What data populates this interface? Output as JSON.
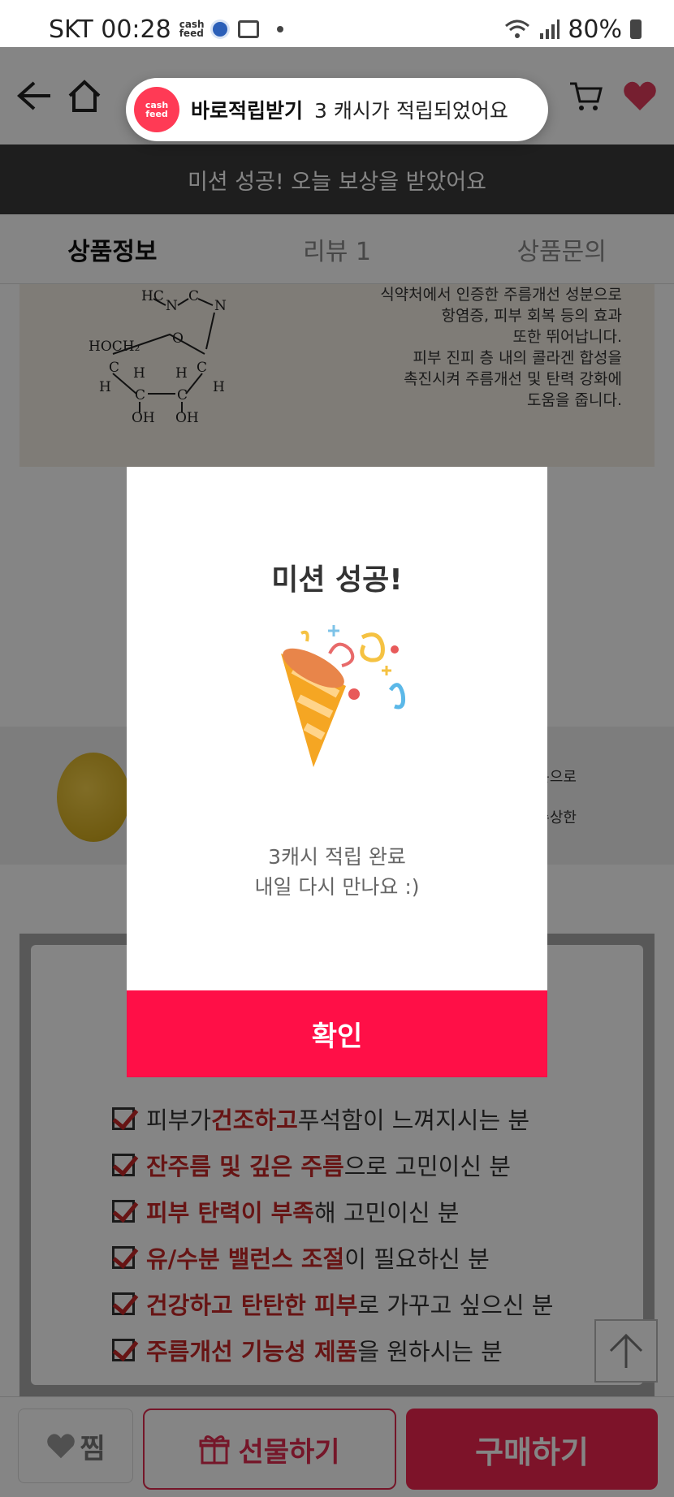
{
  "status_bar": {
    "carrier_time": "SKT 00:28",
    "app_label": "cash feed",
    "battery": "80%"
  },
  "toast": {
    "logo": "cash feed",
    "title": "바로적립받기",
    "message": "3 캐시가 적립되었어요"
  },
  "banner": {
    "text": "미션 성공! 오늘 보상을 받았어요"
  },
  "tabs": [
    {
      "label": "상품정보"
    },
    {
      "label": "리뷰 1"
    },
    {
      "label": "상품문의"
    }
  ],
  "content": {
    "chem_text": [
      "식약처에서 인증한 주름개선 성분으로",
      "항염증, 피부 회복 등의 효과",
      "또한 뛰어납니다.",
      "피부 진피 층 내의 콜라겐 합성을",
      "촉진시켜 주름개선 및 탄력 강화에",
      "도움을 줍니다."
    ],
    "band_text": [
      "성분으로",
      "벨상을 수상한"
    ],
    "checks": [
      {
        "pre": "피부가 ",
        "hl": "건조하고",
        "post": " 푸석함이 느껴지시는 분"
      },
      {
        "pre": "",
        "hl": "잔주름 및 깊은 주름",
        "post": "으로 고민이신 분"
      },
      {
        "pre": "",
        "hl": "피부 탄력이 부족",
        "post": "해 고민이신 분"
      },
      {
        "pre": "",
        "hl": "유/수분 밸런스 조절",
        "post": "이 필요하신 분"
      },
      {
        "pre": "",
        "hl": "건강하고 탄탄한 피부",
        "post": "로 가꾸고 싶으신 분"
      },
      {
        "pre": "",
        "hl": "주름개선 기능성 제품",
        "post": "을 원하시는 분"
      }
    ]
  },
  "bottom_bar": {
    "wish_label": "찜",
    "gift_label": "선물하기",
    "buy_label": "구매하기"
  },
  "modal": {
    "title": "미션 성공!",
    "message_line1": "3캐시 적립 완료",
    "message_line2": "내일 다시 만나요 :)",
    "confirm_label": "확인"
  },
  "colors": {
    "accent": "#ff0f47",
    "banner_bg": "#3a3a3a",
    "highlight": "#c62828"
  }
}
